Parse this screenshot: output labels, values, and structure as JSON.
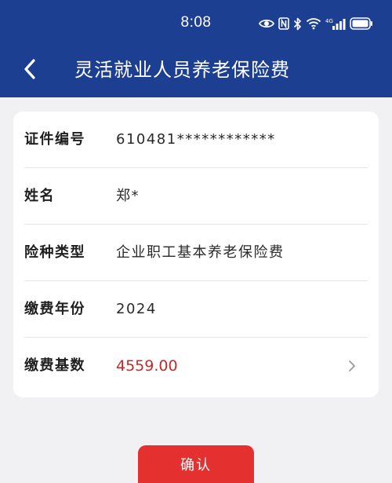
{
  "status_bar": {
    "time": "8:08",
    "icons": [
      "eye-icon",
      "nfc-icon",
      "bluetooth-icon",
      "wifi-icon",
      "signal-4g-icon",
      "battery-icon"
    ],
    "network_label": "4G"
  },
  "nav": {
    "title": "灵活就业人员养老保险费",
    "back_icon": "chevron-left-icon"
  },
  "colors": {
    "header_bg": "#1d3f91",
    "amount": "#c42a2a",
    "confirm_button": "#e53030",
    "page_bg": "#f1f1f4"
  },
  "form": {
    "rows": [
      {
        "label": "证件编号",
        "value": "610481************"
      },
      {
        "label": "姓名",
        "value": "郑*"
      },
      {
        "label": "险种类型",
        "value": "企业职工基本养老保险费"
      },
      {
        "label": "缴费年份",
        "value": "2024"
      },
      {
        "label": "缴费基数",
        "value": "4559.00",
        "icon": "chevron-right-icon"
      }
    ]
  },
  "actions": {
    "confirm_label": "确认"
  }
}
